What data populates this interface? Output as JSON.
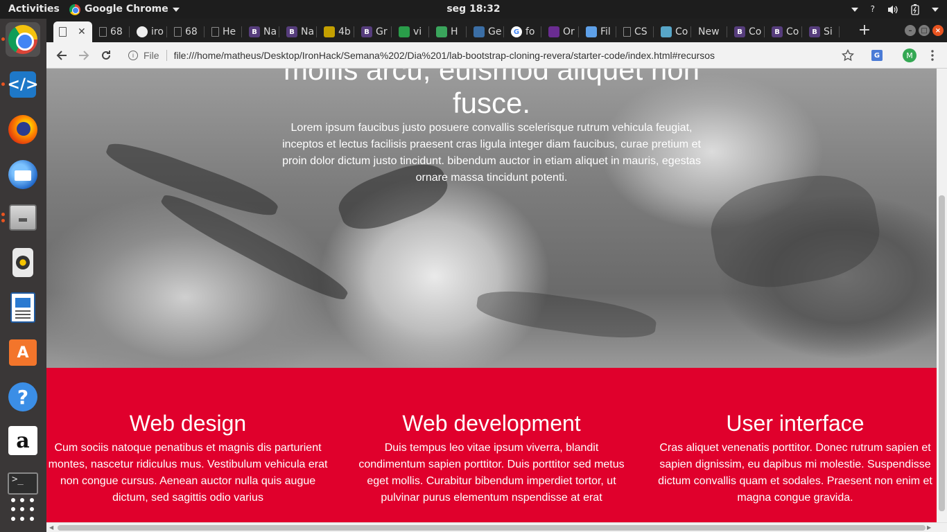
{
  "topbar": {
    "activities": "Activities",
    "app_name": "Google Chrome",
    "clock": "seg 18:32",
    "tray_help": "?"
  },
  "dock": {
    "apps": [
      "chrome-icon",
      "vscode-icon",
      "firefox-icon",
      "thunderbird-icon",
      "files-icon",
      "rhythmbox-icon",
      "libreoffice-writer-icon",
      "software-center-icon",
      "help-icon",
      "amazon-icon",
      "terminal-icon",
      "show-apps-icon"
    ]
  },
  "browser": {
    "tabs": [
      {
        "label": "",
        "favicon": "doc-icon",
        "color": "#666666",
        "active": true
      },
      {
        "label": "68",
        "favicon": "doc-icon",
        "color": "#777777"
      },
      {
        "label": "iro",
        "favicon": "github-icon",
        "color": "#eeeeee"
      },
      {
        "label": "68",
        "favicon": "doc-icon",
        "color": "#777777"
      },
      {
        "label": "He",
        "favicon": "doc-icon",
        "color": "#777777"
      },
      {
        "label": "Na",
        "favicon": "bootstrap-icon",
        "color": "#563d7c"
      },
      {
        "label": "Na",
        "favicon": "bootstrap-icon",
        "color": "#563d7c"
      },
      {
        "label": "4b",
        "favicon": "4b-icon",
        "color": "#c4a000"
      },
      {
        "label": "Gr",
        "favicon": "bootstrap-icon",
        "color": "#563d7c"
      },
      {
        "label": "vi",
        "favicon": "green-icon",
        "color": "#2a9d4a"
      },
      {
        "label": "H",
        "favicon": "chart-icon",
        "color": "#3aa55c"
      },
      {
        "label": "Ge",
        "favicon": "blue-icon",
        "color": "#3b6ea5"
      },
      {
        "label": "fo",
        "favicon": "google-icon",
        "color": "#4285f4"
      },
      {
        "label": "Or",
        "favicon": "purple-icon",
        "color": "#6a2c91"
      },
      {
        "label": "Fil",
        "favicon": "line-icon",
        "color": "#5ea0e8"
      },
      {
        "label": "CS",
        "favicon": "doc-icon",
        "color": "#777777"
      },
      {
        "label": "Co",
        "favicon": "codepen-icon",
        "color": "#58a6c8"
      },
      {
        "label": "New",
        "favicon": "",
        "color": ""
      },
      {
        "label": "Co",
        "favicon": "bootstrap-icon",
        "color": "#563d7c"
      },
      {
        "label": "Co",
        "favicon": "bootstrap-icon",
        "color": "#563d7c"
      },
      {
        "label": "Si",
        "favicon": "bootstrap-icon",
        "color": "#563d7c"
      }
    ],
    "new_tab": "+",
    "url_scheme": "File",
    "url": "file:///home/matheus/Desktop/IronHack/Semana%202/Dia%201/lab-bootstrap-cloning-revera/starter-code/index.html#recursos",
    "profile_initial": "M"
  },
  "page": {
    "hero": {
      "title": "mollis arcu, euismod aliquet non fusce.",
      "text": "Lorem ipsum faucibus justo posuere convallis scelerisque rutrum vehicula feugiat, inceptos et lectus facilisis praesent cras ligula integer diam faucibus, curae pretium et proin dolor dictum justo tincidunt. bibendum auctor in etiam aliquet in mauris, egestas ornare massa tincidunt potenti."
    },
    "services": [
      {
        "title": "Web design",
        "text": "Cum sociis natoque penatibus et magnis dis parturient montes, nascetur ridiculus mus. Vestibulum vehicula erat non congue cursus. Aenean auctor nulla quis augue dictum, sed sagittis odio varius"
      },
      {
        "title": "Web development",
        "text": "Duis tempus leo vitae ipsum viverra, blandit condimentum sapien porttitor. Duis porttitor sed metus eget mollis. Curabitur bibendum imperdiet tortor, ut pulvinar purus elementum nspendisse at erat"
      },
      {
        "title": "User interface",
        "text": "Cras aliquet venenatis porttitor. Donec rutrum sapien et sapien dignissim, eu dapibus mi molestie. Suspendisse dictum convallis quam et sodales. Praesent non enim et magna congue gravida."
      }
    ],
    "colors": {
      "services_bg": "#e0002c",
      "text": "#ffffff"
    }
  }
}
